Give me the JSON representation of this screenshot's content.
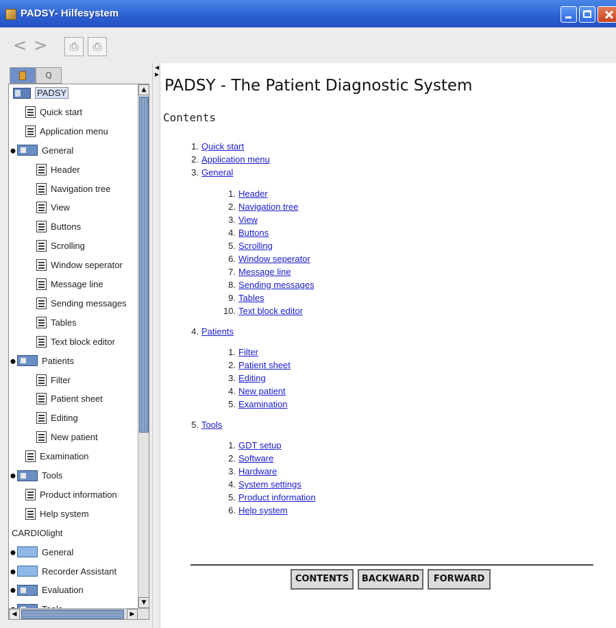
{
  "window": {
    "title": "PADSY- Hilfesystem"
  },
  "toolbar": {
    "back": "<",
    "forward": ">",
    "print": "⎙",
    "page_setup": "⎙"
  },
  "sidebar": {
    "tabs": {
      "search_glyph": "Q"
    },
    "tree": [
      {
        "label": "PADSY"
      },
      {
        "label": "Quick start"
      },
      {
        "label": "Application menu"
      },
      {
        "label": "General"
      },
      {
        "label": "Header"
      },
      {
        "label": "Navigation tree"
      },
      {
        "label": "View"
      },
      {
        "label": "Buttons"
      },
      {
        "label": "Scrolling"
      },
      {
        "label": "Window seperator"
      },
      {
        "label": "Message line"
      },
      {
        "label": "Sending messages"
      },
      {
        "label": "Tables"
      },
      {
        "label": "Text block editor"
      },
      {
        "label": "Patients"
      },
      {
        "label": "Filter"
      },
      {
        "label": "Patient sheet"
      },
      {
        "label": "Editing"
      },
      {
        "label": "New patient"
      },
      {
        "label": "Examination"
      },
      {
        "label": "Tools"
      },
      {
        "label": "Product information"
      },
      {
        "label": "Help system"
      },
      {
        "label": "CARDIOlight"
      },
      {
        "label": "General"
      },
      {
        "label": "Recorder Assistant"
      },
      {
        "label": "Evaluation"
      },
      {
        "label": "Tools"
      }
    ]
  },
  "content": {
    "title": "PADSY -  The Patient Diagnostic System",
    "contents_heading": "Contents",
    "toc": [
      {
        "num": "1.",
        "label": "Quick start"
      },
      {
        "num": "2.",
        "label": "Application menu"
      },
      {
        "num": "3.",
        "label": "General"
      }
    ],
    "general_items": [
      {
        "num": "1.",
        "label": "Header"
      },
      {
        "num": "2.",
        "label": "Navigation tree"
      },
      {
        "num": "3.",
        "label": "View"
      },
      {
        "num": "4.",
        "label": "Buttons"
      },
      {
        "num": "5.",
        "label": "Scrolling"
      },
      {
        "num": "6.",
        "label": "Window seperator"
      },
      {
        "num": "7.",
        "label": "Message line"
      },
      {
        "num": "8.",
        "label": "Sending messages"
      },
      {
        "num": "9.",
        "label": "Tables"
      },
      {
        "num": "10.",
        "label": "Text block editor"
      }
    ],
    "patients": {
      "num": "4.",
      "label": "Patients"
    },
    "patients_items": [
      {
        "num": "1.",
        "label": "Filter"
      },
      {
        "num": "2.",
        "label": "Patient sheet"
      },
      {
        "num": "3.",
        "label": "Editing"
      },
      {
        "num": "4.",
        "label": "New patient"
      },
      {
        "num": "5.",
        "label": "Examination"
      }
    ],
    "tools": {
      "num": "5.",
      "label": "Tools"
    },
    "tools_items": [
      {
        "num": "1.",
        "label": "GDT setup"
      },
      {
        "num": "2.",
        "label": "Software"
      },
      {
        "num": "3.",
        "label": "Hardware"
      },
      {
        "num": "4.",
        "label": "System settings"
      },
      {
        "num": "5.",
        "label": "Product information"
      },
      {
        "num": "6.",
        "label": "Help system"
      }
    ],
    "nav_buttons": {
      "contents": "CONTENTS",
      "backward": "BACKWARD",
      "forward": "FORWARD"
    }
  }
}
